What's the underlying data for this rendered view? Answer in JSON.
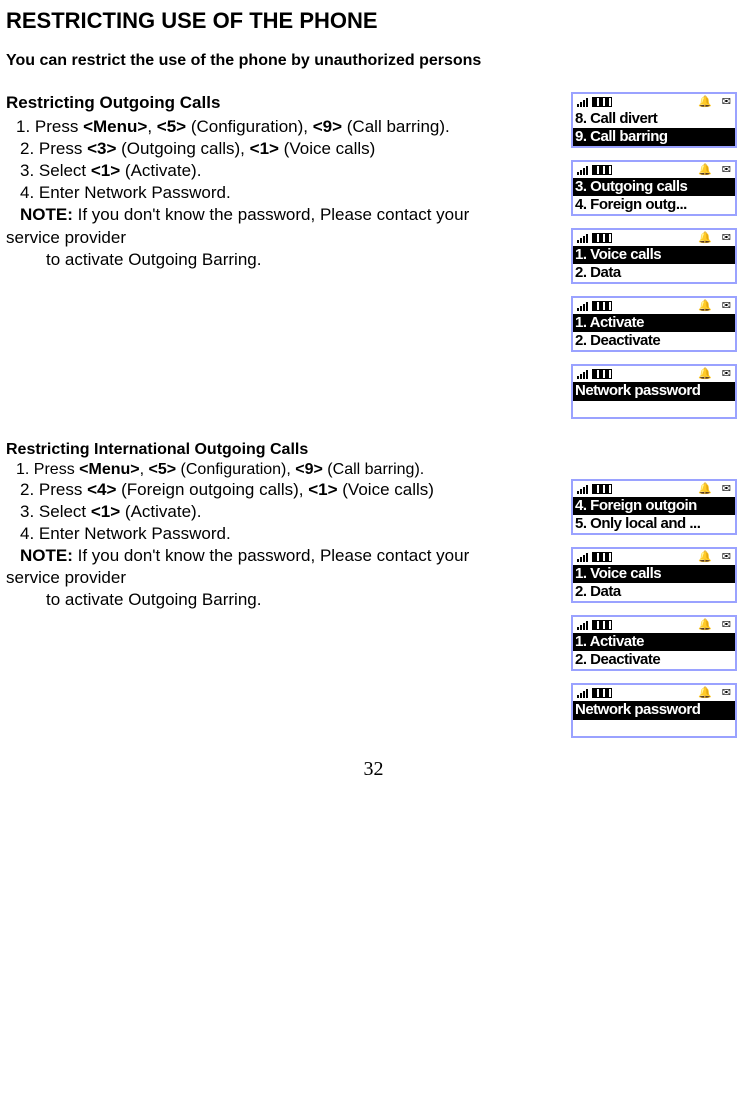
{
  "title": "RESTRICTING USE OF THE PHONE",
  "intro": "You can restrict the use of the phone by unauthorized persons",
  "section1": {
    "heading": "Restricting Outgoing Calls",
    "step1_a": "1. Press ",
    "step1_b1": "<Menu>",
    "step1_c": ", ",
    "step1_b2": "<5>",
    "step1_d": " (Configuration), ",
    "step1_b3": "<9>",
    "step1_e": " (Call barring).",
    "step2_a": "2. Press ",
    "step2_b1": "<3>",
    "step2_c": " (Outgoing calls), ",
    "step2_b2": "<1>",
    "step2_d": " (Voice calls)",
    "step3_a": "3. Select ",
    "step3_b": "<1>",
    "step3_c": " (Activate).",
    "step4": "4. Enter Network Password.",
    "note_label": "NOTE:",
    "note_a": " If you don't know the password, Please contact your",
    "note_b": "service provider",
    "note_c": "to activate Outgoing Barring."
  },
  "section2": {
    "heading": "Restricting International Outgoing Calls",
    "step1_a": "1. Press ",
    "step1_b1": "<Menu>",
    "step1_c": ", ",
    "step1_b2": "<5>",
    "step1_d": " (Configuration), ",
    "step1_b3": "<9>",
    "step1_e": " (Call barring).",
    "step2_a": "2. Press ",
    "step2_b1": "<4>",
    "step2_c": " (Foreign outgoing calls), ",
    "step2_b2": "<1>",
    "step2_d": " (Voice calls)",
    "step3_a": "3. Select ",
    "step3_b": "<1>",
    "step3_c": " (Activate).",
    "step4": "4. Enter Network Password.",
    "note_label": "NOTE:",
    "note_a": " If you don't know the password, Please contact your",
    "note_b": "service provider",
    "note_c": "to activate Outgoing Barring."
  },
  "screens1": [
    {
      "rows": [
        {
          "t": "8. Call divert",
          "sel": false
        },
        {
          "t": "9. Call barring",
          "sel": true
        }
      ]
    },
    {
      "rows": [
        {
          "t": "3. Outgoing calls",
          "sel": true
        },
        {
          "t": "4. Foreign outg...",
          "sel": false
        }
      ]
    },
    {
      "rows": [
        {
          "t": "1. Voice calls",
          "sel": true
        },
        {
          "t": "2. Data",
          "sel": false
        }
      ]
    },
    {
      "rows": [
        {
          "t": "1. Activate",
          "sel": true
        },
        {
          "t": "2. Deactivate",
          "sel": false
        }
      ]
    },
    {
      "prompt": "Network password"
    }
  ],
  "screens2": [
    {
      "rows": [
        {
          "t": "4. Foreign outgoin",
          "sel": true
        },
        {
          "t": "5. Only local and ...",
          "sel": false
        }
      ]
    },
    {
      "rows": [
        {
          "t": "1. Voice calls",
          "sel": true
        },
        {
          "t": "2. Data",
          "sel": false
        }
      ]
    },
    {
      "rows": [
        {
          "t": "1. Activate",
          "sel": true
        },
        {
          "t": "2. Deactivate",
          "sel": false
        }
      ]
    },
    {
      "prompt": "Network password"
    }
  ],
  "page_number": "32"
}
